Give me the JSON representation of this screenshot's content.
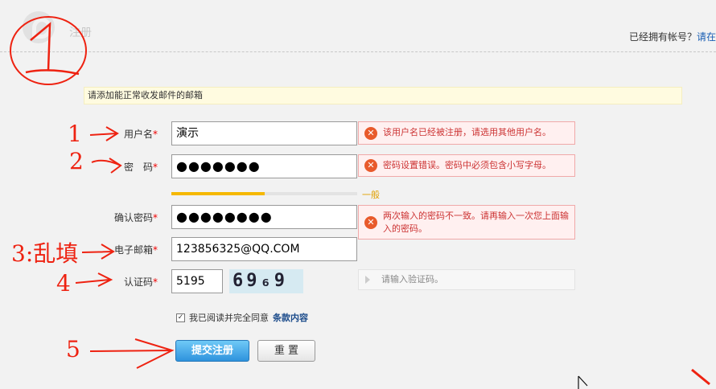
{
  "header": {
    "title": "注册",
    "login_prompt": "已经拥有帐号？",
    "login_link": "请在"
  },
  "notice": "请添加能正常收发邮件的邮箱",
  "form": {
    "username": {
      "label": "用户名",
      "value": "演示",
      "error": "该用户名已经被注册，请选用其他用户名。"
    },
    "password": {
      "label": "密　码",
      "value": "●●●●●●●",
      "error": "密码设置错误。密码中必须包含小写字母。",
      "strength_label": "一般",
      "strength": 0.5
    },
    "confirm": {
      "label": "确认密码",
      "value": "●●●●●●●●",
      "error": "两次输入的密码不一致。请再输入一次您上面输入的密码。"
    },
    "email": {
      "label": "电子邮箱",
      "value": "123856325@QQ.COM"
    },
    "captcha": {
      "label": "认证码",
      "value": "5195",
      "image_text": "69₆9",
      "hint": "请输入验证码。"
    },
    "required_mark": "*",
    "agree": {
      "checked_mark": "✓",
      "text": "我已阅读并完全同意",
      "link": "条款内容"
    },
    "submit_label": "提交注册",
    "reset_label": "重 置"
  },
  "annotations": {
    "one": "1",
    "two": "2",
    "three": "3:乱填",
    "four": "4",
    "five": "5"
  },
  "colors": {
    "annotation_red": "#e21",
    "error_red": "#c33",
    "submit_blue": "#2e93dd"
  }
}
